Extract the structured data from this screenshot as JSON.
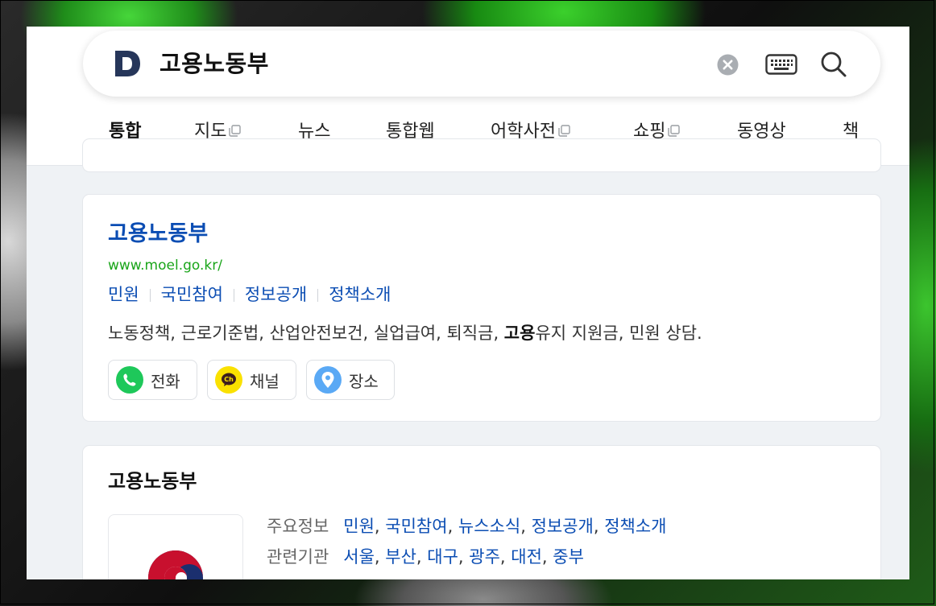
{
  "search": {
    "logo_letter": "D",
    "query": "고용노동부"
  },
  "tabs": [
    {
      "label": "통합",
      "active": true,
      "external": false
    },
    {
      "label": "지도",
      "active": false,
      "external": true
    },
    {
      "label": "뉴스",
      "active": false,
      "external": false
    },
    {
      "label": "통합웹",
      "active": false,
      "external": false
    },
    {
      "label": "어학사전",
      "active": false,
      "external": true
    },
    {
      "label": "쇼핑",
      "active": false,
      "external": true
    },
    {
      "label": "동영상",
      "active": false,
      "external": false
    },
    {
      "label": "책",
      "active": false,
      "external": false
    }
  ],
  "result": {
    "title": "고용노동부",
    "url": "www.moel.go.kr/",
    "sublinks": [
      "민원",
      "국민참여",
      "정보공개",
      "정책소개"
    ],
    "desc_before": "노동정책, 근로기준법, 산업안전보건, 실업급여, 퇴직금, ",
    "desc_bold": "고용",
    "desc_after": "유지 지원금, 민원 상담.",
    "chips": [
      {
        "label": "전화",
        "icon": "phone-icon",
        "color": "#1ec85a"
      },
      {
        "label": "채널",
        "icon": "kakao-channel-icon",
        "color": "#fae100"
      },
      {
        "label": "장소",
        "icon": "map-pin-icon",
        "color": "#5aa9f5"
      }
    ]
  },
  "org": {
    "title": "고용노동부",
    "rows": [
      {
        "label": "주요정보",
        "links": [
          "민원",
          "국민참여",
          "뉴스소식",
          "정보공개",
          "정책소개"
        ]
      },
      {
        "label": "관련기관",
        "links": [
          "서울",
          "부산",
          "대구",
          "광주",
          "대전",
          "중부"
        ]
      }
    ]
  },
  "colors": {
    "link": "#0b4db3",
    "url": "#1aa51a",
    "logo": "#26365a"
  }
}
